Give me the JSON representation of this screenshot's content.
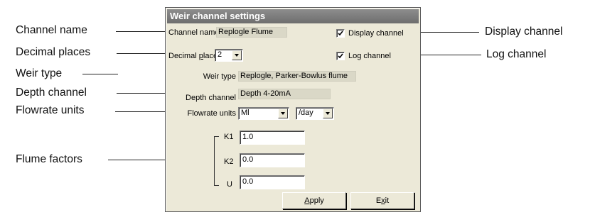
{
  "dialog": {
    "title": "Weir channel settings",
    "channel_name_label": "Channel name",
    "channel_name_value": "Replogle Flume",
    "display_channel_label": "Display channel",
    "display_channel_checked": true,
    "decimal_places_label_pre": "Decimal ",
    "decimal_places_label_accel": "p",
    "decimal_places_label_post": "laces",
    "decimal_places_value": "2",
    "log_channel_label": "Log channel",
    "log_channel_checked": true,
    "weir_type_label": "Weir type",
    "weir_type_value": "Replogle, Parker-Bowlus flume",
    "depth_channel_label": "Depth channel",
    "depth_channel_value": "Depth 4-20mA",
    "flowrate_units_label": "Flowrate units",
    "flowrate_units_value": "Ml",
    "flowrate_period_value": "/day",
    "k1_label": "K1",
    "k1_value": "1.0",
    "k2_label": "K2",
    "k2_value": "0.0",
    "u_label": "U",
    "u_value": "0.0",
    "apply_pre": "",
    "apply_accel": "A",
    "apply_post": "pply",
    "exit_pre": "E",
    "exit_accel": "x",
    "exit_post": "it"
  },
  "callouts": {
    "channel_name": "Channel name",
    "decimal_places": "Decimal places",
    "weir_type": "Weir type",
    "depth_channel": "Depth channel",
    "flowrate_units": "Flowrate units",
    "flume_factors": "Flume factors",
    "display_channel": "Display channel",
    "log_channel": "Log channel"
  }
}
